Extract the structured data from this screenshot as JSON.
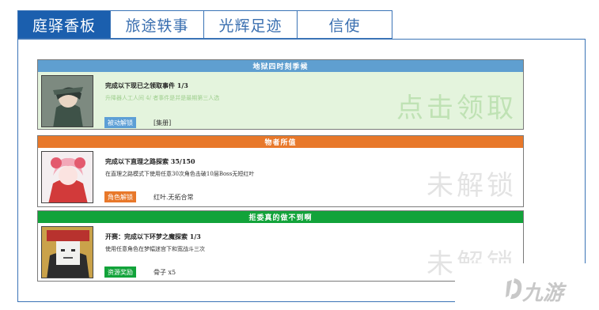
{
  "tabs": [
    {
      "label": "庭驿香板",
      "active": true
    },
    {
      "label": "旅途轶事",
      "active": false
    },
    {
      "label": "光辉足迹",
      "active": false
    },
    {
      "label": "信使",
      "active": false
    }
  ],
  "cards": [
    {
      "header": "地狱四时刻季候",
      "header_color": "#5f9fd0",
      "title": "完成以下现已之领取事件 1/3",
      "desc": "升降器人工人间 4/ 者事件是并是最期第三人选",
      "button": "被动解锁",
      "button_color": "#5d9fd6",
      "reward": "[集册]",
      "status": "点击领取",
      "status_color": "#bfe2b4",
      "body_bg": "#e4f4dd"
    },
    {
      "header": "物者所值",
      "header_color": "#e8782a",
      "title": "完成以下直理之路探索 35/150",
      "desc": "在直理之路模式下使用任意30次角色击破10层Boss无短红叶",
      "button": "角色解锁",
      "button_color": "#e8782a",
      "reward": "红叶.无拓合常",
      "status": "未解锁",
      "status_color": "#e3e3e3",
      "body_bg": "#ffffff"
    },
    {
      "header": "拒委真的做不到啊",
      "header_color": "#12a33a",
      "title": "开赛：完成以下环梦之魔探索 1/3",
      "desc": "使用任意角色在梦幅迷宫下和宽战斗三次",
      "button": "资源奖励",
      "button_color": "#12a33a",
      "reward": "骨子 x5",
      "status": "未解锁",
      "status_color": "#e3e3e3",
      "body_bg": "#ffffff"
    }
  ],
  "watermark": {
    "text": "九游"
  }
}
